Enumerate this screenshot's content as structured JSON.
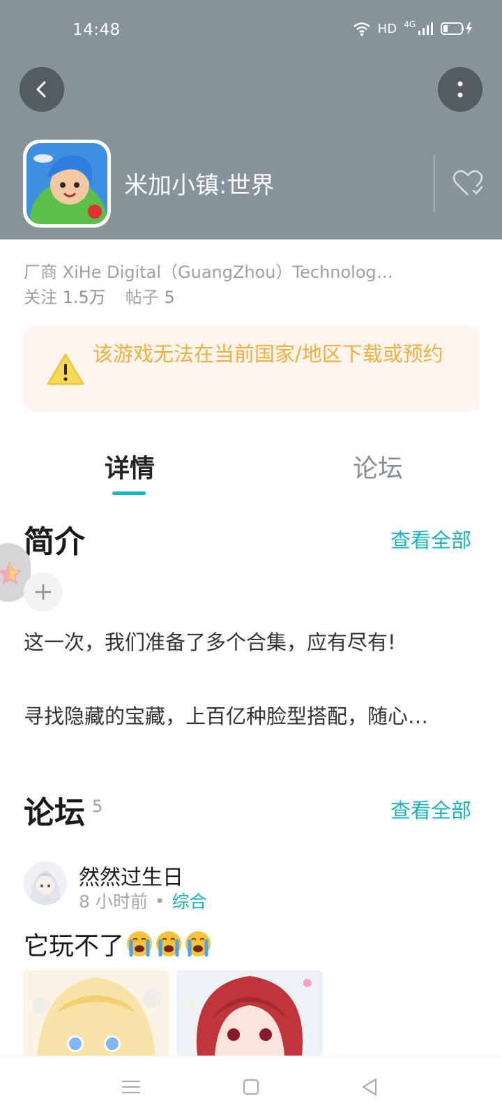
{
  "status_bar": {
    "time": "14:48",
    "hd": "HD",
    "network": "4G"
  },
  "app": {
    "title": "米加小镇:世界",
    "developer": "厂商 XiHe Digital（GuangZhou）Technolog…",
    "follow_label": "关注",
    "follow_count": "1.5万",
    "posts_label": "帖子",
    "posts_count": "5"
  },
  "warning": {
    "text": "该游戏无法在当前国家/地区下载或预约"
  },
  "tabs": [
    {
      "label": "详情",
      "active": true
    },
    {
      "label": "论坛",
      "active": false
    }
  ],
  "intro": {
    "title": "简介",
    "see_all": "查看全部",
    "line1": "这一次，我们准备了多个合集，应有尽有!",
    "line2": "寻找隐藏的宝藏，上百亿种脸型搭配，随心…"
  },
  "forum": {
    "title": "论坛",
    "count": "5",
    "see_all": "查看全部",
    "post": {
      "author": "然然过生日",
      "time": "8 小时前",
      "dot": "•",
      "category": "综合",
      "text": "它玩不了"
    }
  },
  "icons": {
    "back": "chevron-left-icon",
    "more": "more-vertical-icon",
    "favorite": "heart-icon",
    "warning": "warning-triangle-icon",
    "plus": "plus-icon",
    "emoji": "crying-face-emoji"
  },
  "colors": {
    "header_bg": "#87939a",
    "accent": "#17b3c2",
    "warning_text": "#f1b03a",
    "warning_bg": "#fdf3ef"
  }
}
